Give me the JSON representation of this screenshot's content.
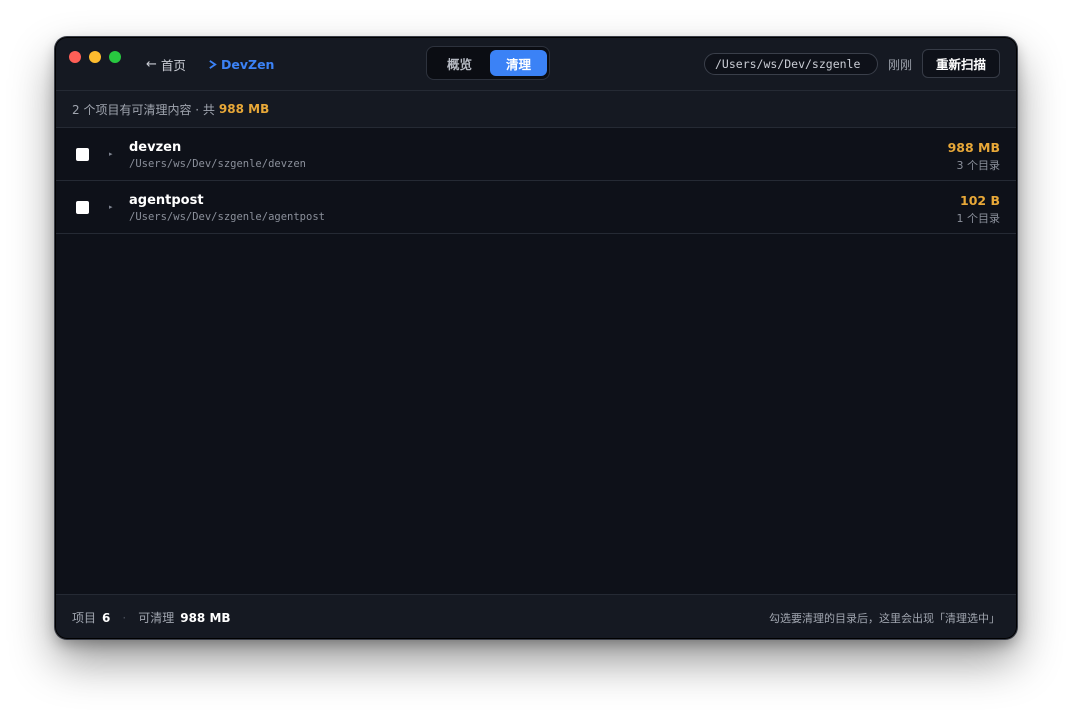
{
  "header": {
    "back_label": "首页",
    "project_name": "DevZen",
    "tabs": [
      {
        "label": "概览",
        "active": false
      },
      {
        "label": "清理",
        "active": true
      }
    ],
    "path": "/Users/ws/Dev/szgenle",
    "scan_time": "刚刚",
    "rescan_label": "重新扫描"
  },
  "summary": {
    "text": "2 个项目有可清理内容 · 共",
    "total": "988 MB"
  },
  "projects": [
    {
      "name": "devzen",
      "path": "/Users/ws/Dev/szgenle/devzen",
      "size": "988 MB",
      "dirs": "3 个目录",
      "checked": false
    },
    {
      "name": "agentpost",
      "path": "/Users/ws/Dev/szgenle/agentpost",
      "size": "102 B",
      "dirs": "1 个目录",
      "checked": false
    }
  ],
  "footer": {
    "projects_label": "项目",
    "projects_count": "6",
    "cleanable_label": "可清理",
    "cleanable_value": "988 MB",
    "hint": "勾选要清理的目录后，这里会出现「清理选中」"
  },
  "colors": {
    "accent": "#3b82f6",
    "size_highlight": "#e8a838",
    "background": "#0e1119"
  },
  "icons": {
    "back": "arrow-left-icon",
    "project": "devzen-logo-icon",
    "expand": "caret-right-icon"
  }
}
